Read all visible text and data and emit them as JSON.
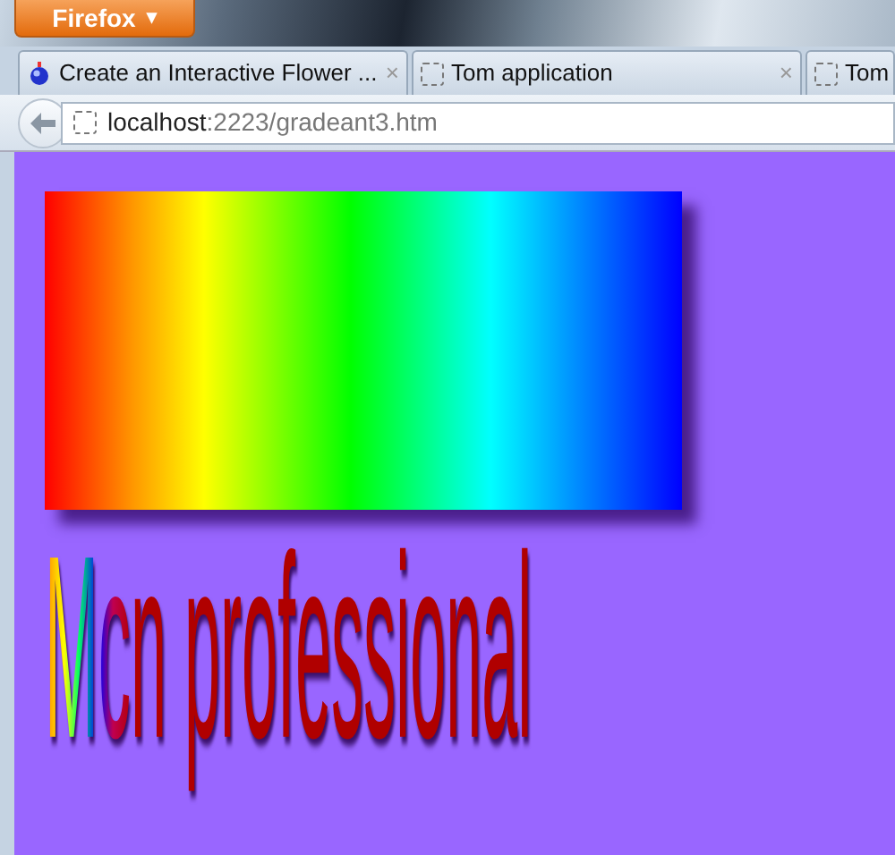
{
  "app_button": {
    "label": "Firefox",
    "caret": "▾"
  },
  "tabs": [
    {
      "label": "Create an Interactive Flower ...",
      "kind": "favicon",
      "close": "×"
    },
    {
      "label": "Tom application",
      "kind": "blank",
      "close": "×"
    },
    {
      "label": "Tom",
      "kind": "blank"
    }
  ],
  "address_bar": {
    "host": "localhost",
    "path": ":2223/gradeant3.htm"
  },
  "page": {
    "heading": "Mcn professional"
  }
}
